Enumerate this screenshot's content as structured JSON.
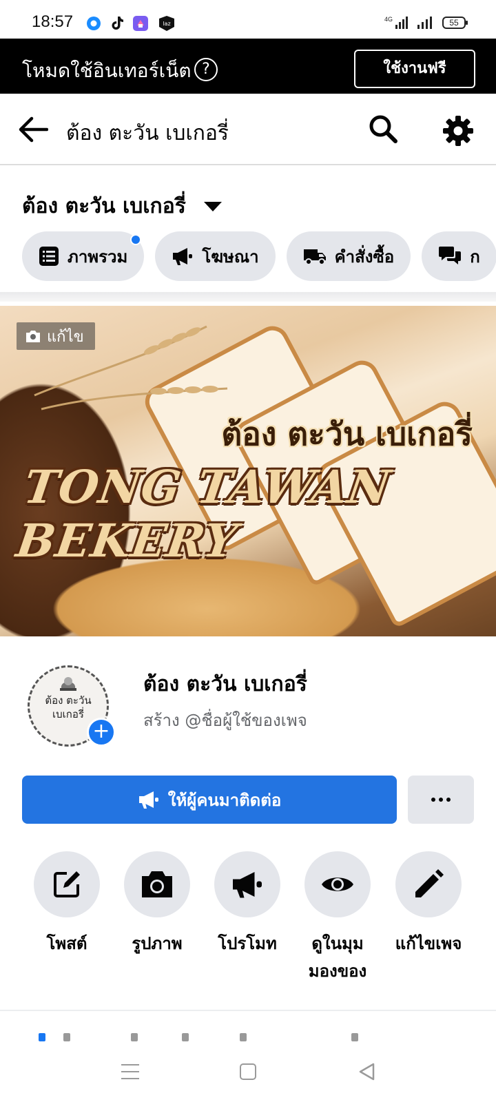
{
  "status_bar": {
    "time": "18:57",
    "network": "4G",
    "battery": "55",
    "app_icons": [
      "location-icon",
      "tiktok-icon",
      "shortcut-app-icon",
      "lazada-icon"
    ]
  },
  "free_mode": {
    "label": "โหมดใช้อินเทอร์เน็ต",
    "help": "?",
    "button": "ใช้งานฟรี"
  },
  "header": {
    "title": "ต้อง ตะวัน เบเกอรี่"
  },
  "page_selector": {
    "name": "ต้อง ตะวัน เบเกอรี่"
  },
  "chips": [
    {
      "label": "ภาพรวม",
      "icon": "list-icon",
      "dot": true
    },
    {
      "label": "โฆษณา",
      "icon": "megaphone-icon",
      "dot": false
    },
    {
      "label": "คำสั่งซื้อ",
      "icon": "truck-icon",
      "dot": false
    },
    {
      "label": "ก",
      "icon": "chat-icon",
      "dot": false
    }
  ],
  "cover": {
    "edit_label": "แก้ไข",
    "thai_title": "ต้อง ตะวัน เบเกอรี่",
    "english_title": "TONG TAWAN BEKERY"
  },
  "profile": {
    "avatar_text_line1": "ต้อง ตะวัน",
    "avatar_text_line2": "เบเกอรี่",
    "name": "ต้อง ตะวัน เบเกอรี่",
    "subtitle": "สร้าง @ชื่อผู้ใช้ของเพจ"
  },
  "cta": {
    "label": "ให้ผู้คนมาติดต่อ",
    "more": "..."
  },
  "quick_actions": [
    {
      "label": "โพสต์",
      "icon": "edit-square-icon"
    },
    {
      "label": "รูปภาพ",
      "icon": "camera-icon"
    },
    {
      "label": "โปรโมท",
      "icon": "megaphone-icon"
    },
    {
      "label": "ดูในมุม\nมองของ",
      "icon": "eye-icon"
    },
    {
      "label": "แก้ไขเพจ",
      "icon": "pencil-icon"
    }
  ],
  "colors": {
    "accent": "#2374e1",
    "chip_bg": "#e4e6eb",
    "free_bar": "#000000"
  }
}
